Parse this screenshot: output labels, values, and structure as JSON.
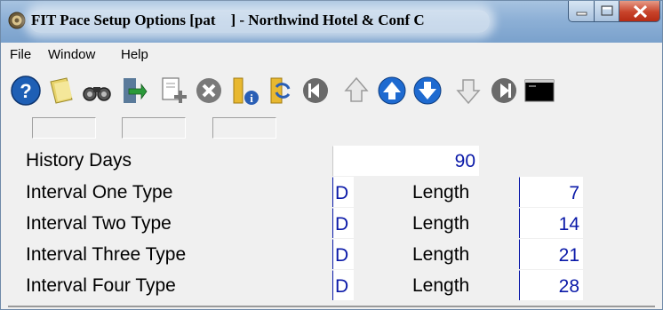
{
  "window": {
    "title": "FIT Pace Setup Options [pat    ] - Northwind Hotel & Conf C"
  },
  "menu": {
    "items": [
      {
        "label": "File"
      },
      {
        "label": "Window"
      },
      {
        "label": "Help"
      }
    ]
  },
  "toolbar": {
    "tools": [
      "help-icon",
      "notes-icon",
      "binoculars-icon",
      "exit-door-icon",
      "new-record-icon",
      "delete-icon",
      "folder-info-icon",
      "refresh-icon",
      "first-record-icon",
      "previous-page-icon",
      "previous-record-icon",
      "next-record-icon",
      "next-page-icon",
      "last-record-icon",
      "console-icon"
    ]
  },
  "form": {
    "history_days": {
      "label": "History Days",
      "value": "90"
    },
    "intervals": [
      {
        "label": "Interval One Type",
        "type": "D",
        "length_label": "Length",
        "length": "7"
      },
      {
        "label": "Interval Two Type",
        "type": "D",
        "length_label": "Length",
        "length": "14"
      },
      {
        "label": "Interval Three Type",
        "type": "D",
        "length_label": "Length",
        "length": "21"
      },
      {
        "label": "Interval Four Type",
        "type": "D",
        "length_label": "Length",
        "length": "28"
      }
    ]
  },
  "colors": {
    "field_text": "#0a19a8",
    "titlebar": "#8db0d6",
    "close_button": "#c8432a"
  }
}
